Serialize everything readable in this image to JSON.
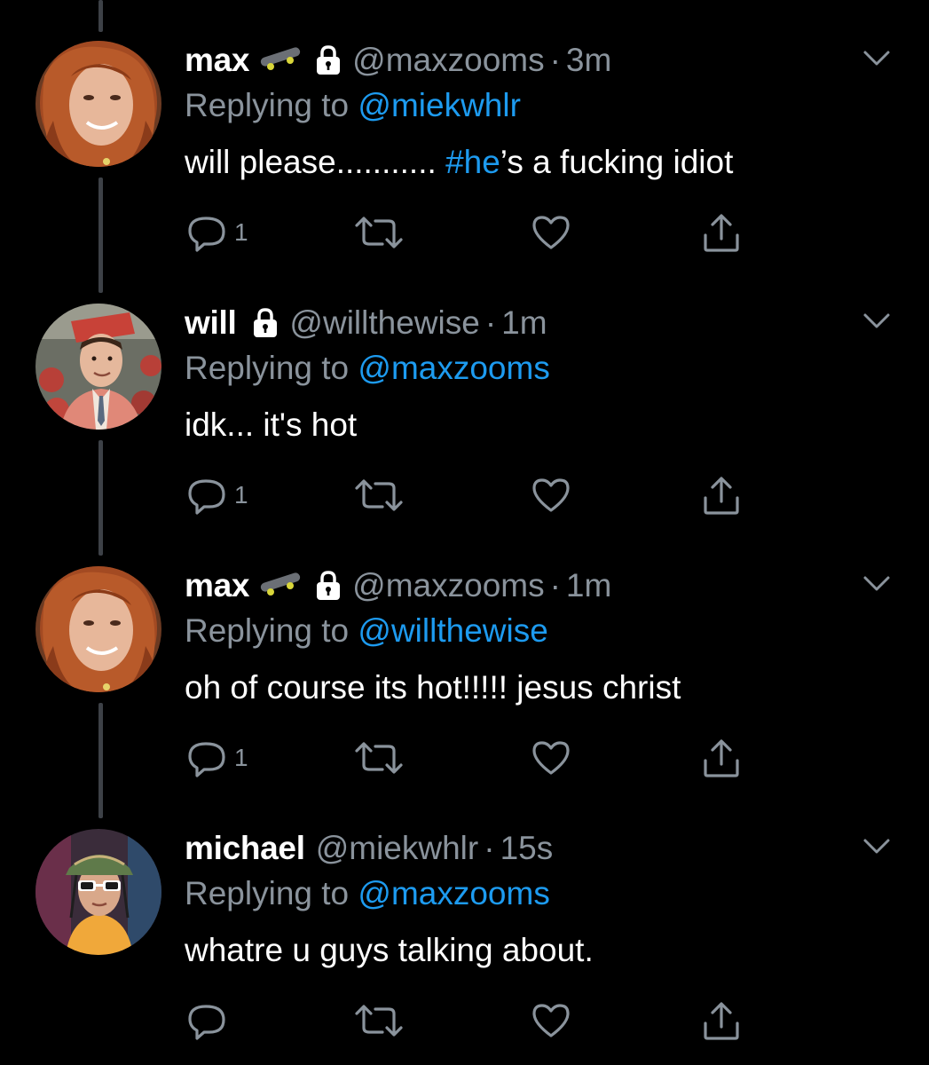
{
  "colors": {
    "background": "#000000",
    "text": "#ffffff",
    "muted": "#8a939c",
    "link": "#1d9bf0",
    "thread_line": "#3d4147"
  },
  "tweets": [
    {
      "name": "max",
      "has_skateboard_emoji": true,
      "has_lock_emoji": true,
      "handle": "@maxzooms",
      "separator": "·",
      "time": "3m",
      "replying_prefix": "Replying to ",
      "replying_to": "@miekwhlr",
      "text_before": "will please........... ",
      "hashtag": "#he",
      "text_after": "’s a fucking idiot",
      "reply_count": "1",
      "avatar": "red-haired-girl-avatar"
    },
    {
      "name": "will",
      "has_skateboard_emoji": false,
      "has_lock_emoji": true,
      "handle": "@willthewise",
      "separator": "·",
      "time": "1m",
      "replying_prefix": "Replying to ",
      "replying_to": "@maxzooms",
      "text_before": "idk... it's hot",
      "hashtag": "",
      "text_after": "",
      "reply_count": "1",
      "avatar": "graduation-boy-avatar"
    },
    {
      "name": "max",
      "has_skateboard_emoji": true,
      "has_lock_emoji": true,
      "handle": "@maxzooms",
      "separator": "·",
      "time": "1m",
      "replying_prefix": "Replying to ",
      "replying_to": "@willthewise",
      "text_before": "oh of course its hot!!!!! jesus christ",
      "hashtag": "",
      "text_after": "",
      "reply_count": "1",
      "avatar": "red-haired-girl-avatar"
    },
    {
      "name": "michael",
      "has_skateboard_emoji": false,
      "has_lock_emoji": false,
      "handle": "@miekwhlr",
      "separator": "·",
      "time": "15s",
      "replying_prefix": "Replying to ",
      "replying_to": "@maxzooms",
      "text_before": "whatre u guys talking about.",
      "hashtag": "",
      "text_after": "",
      "reply_count": "",
      "avatar": "bucket-hat-sunglasses-avatar"
    }
  ],
  "icons": {
    "reply": "reply-icon",
    "retweet": "retweet-icon",
    "like": "heart-icon",
    "share": "share-icon",
    "more": "chevron-down-icon",
    "lock": "lock-icon",
    "skateboard": "skateboard-icon"
  }
}
